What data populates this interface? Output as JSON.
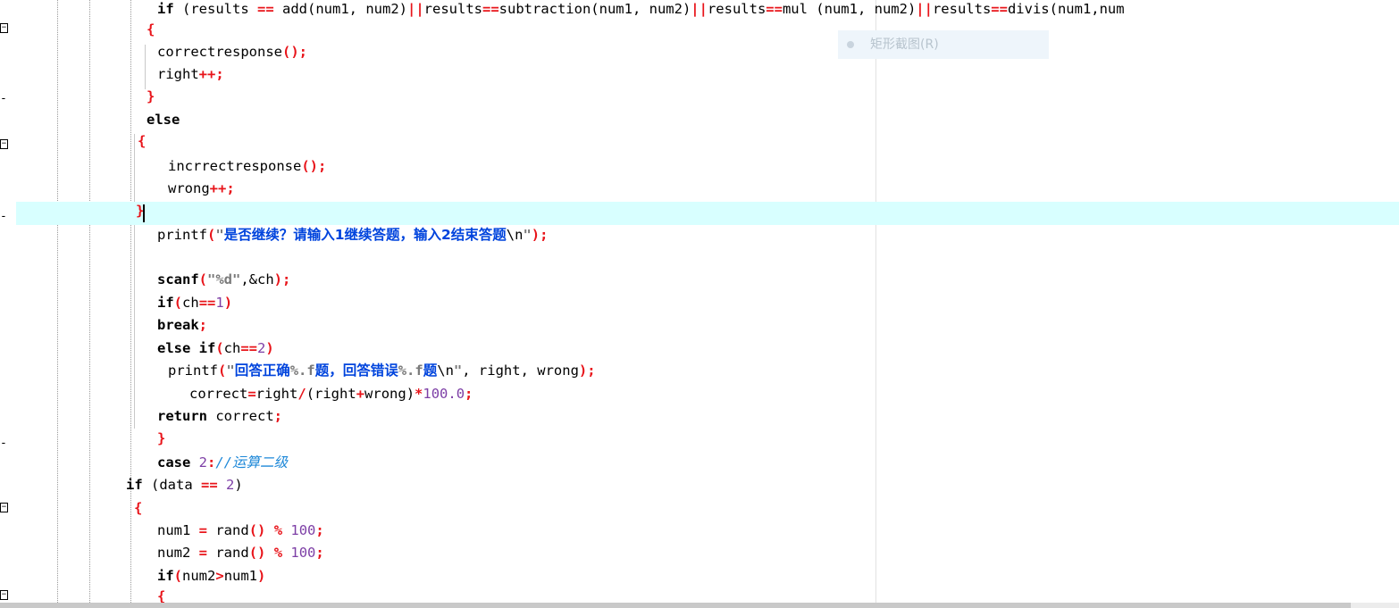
{
  "editor": {
    "lines": [
      [
        [
          "kw",
          "if"
        ],
        [
          "plain",
          " (results "
        ],
        [
          "op",
          "=="
        ],
        [
          "plain",
          " add(num1, num2)"
        ],
        [
          "op",
          "||"
        ],
        [
          "plain",
          "results"
        ],
        [
          "op",
          "=="
        ],
        [
          "plain",
          "subtraction(num1, num2)"
        ],
        [
          "op",
          "||"
        ],
        [
          "plain",
          "results"
        ],
        [
          "op",
          "=="
        ],
        [
          "plain",
          "mul (num1, num2)"
        ],
        [
          "op",
          "||"
        ],
        [
          "plain",
          "results"
        ],
        [
          "op",
          "=="
        ],
        [
          "plain",
          "divis(num1,num"
        ]
      ],
      [
        [
          "op",
          "{"
        ]
      ],
      [
        [
          "plain",
          "correctresponse"
        ],
        [
          "op",
          "();"
        ]
      ],
      [
        [
          "plain",
          "right"
        ],
        [
          "op",
          "++;"
        ]
      ],
      [
        [
          "op",
          "}"
        ]
      ],
      [
        [
          "kw",
          "else"
        ]
      ],
      [
        [
          "op",
          "{"
        ]
      ],
      [
        [
          "plain",
          "incrrectresponse"
        ],
        [
          "op",
          "();"
        ]
      ],
      [
        [
          "plain",
          "wrong"
        ],
        [
          "op",
          "++;"
        ]
      ],
      [
        [
          "op",
          "}"
        ]
      ],
      [
        [
          "plain",
          "printf"
        ],
        [
          "op",
          "("
        ],
        [
          "str",
          "\""
        ],
        [
          "cjk",
          "是否继续？请输入1继续答题，输入2结束答题"
        ],
        [
          "esc",
          "\\n"
        ],
        [
          "str",
          "\""
        ],
        [
          "op",
          ");"
        ]
      ],
      [
        [
          "kw",
          "scanf"
        ],
        [
          "op",
          "("
        ],
        [
          "str",
          "\"%d\""
        ],
        [
          "plain",
          ",&ch"
        ],
        [
          "op",
          ");"
        ]
      ],
      [
        [
          "kw",
          "if"
        ],
        [
          "op",
          "("
        ],
        [
          "plain",
          "ch"
        ],
        [
          "op",
          "=="
        ],
        [
          "num",
          "1"
        ],
        [
          "op",
          ")"
        ]
      ],
      [
        [
          "kw",
          "break"
        ],
        [
          "op",
          ";"
        ]
      ],
      [
        [
          "kw",
          "else if"
        ],
        [
          "op",
          "("
        ],
        [
          "plain",
          "ch"
        ],
        [
          "op",
          "=="
        ],
        [
          "num",
          "2"
        ],
        [
          "op",
          ")"
        ]
      ],
      [
        [
          "plain",
          "printf"
        ],
        [
          "op",
          "("
        ],
        [
          "str",
          "\""
        ],
        [
          "cjk",
          "回答正确"
        ],
        [
          "str",
          "%.f"
        ],
        [
          "cjk",
          "题，回答错误"
        ],
        [
          "str",
          "%.f"
        ],
        [
          "cjk",
          "题"
        ],
        [
          "esc",
          "\\n"
        ],
        [
          "str",
          "\""
        ],
        [
          "plain",
          ", right, wrong"
        ],
        [
          "op",
          ");"
        ]
      ],
      [
        [
          "plain",
          "correct"
        ],
        [
          "op",
          "="
        ],
        [
          "plain",
          "right"
        ],
        [
          "op",
          "/"
        ],
        [
          "plain",
          "(right"
        ],
        [
          "op",
          "+"
        ],
        [
          "plain",
          "wrong)"
        ],
        [
          "op",
          "*"
        ],
        [
          "num",
          "100.0"
        ],
        [
          "op",
          ";"
        ]
      ],
      [
        [
          "kw",
          "return"
        ],
        [
          "plain",
          " correct"
        ],
        [
          "op",
          ";"
        ]
      ],
      [
        [
          "op",
          "}"
        ]
      ],
      [
        [
          "kw",
          "case"
        ],
        [
          "num",
          " 2"
        ],
        [
          "op",
          ":"
        ],
        [
          "comment",
          "//运算二级"
        ]
      ],
      [
        [
          "kw",
          "if"
        ],
        [
          "plain",
          " (data "
        ],
        [
          "op",
          "=="
        ],
        [
          "num",
          " 2"
        ],
        [
          "plain",
          ")"
        ]
      ],
      [
        [
          "op",
          "{"
        ]
      ],
      [
        [
          "plain",
          "num1 "
        ],
        [
          "op",
          "="
        ],
        [
          "plain",
          " rand"
        ],
        [
          "op",
          "()"
        ],
        [
          "plain",
          " "
        ],
        [
          "op",
          "%"
        ],
        [
          "num",
          " 100"
        ],
        [
          "op",
          ";"
        ]
      ],
      [
        [
          "plain",
          "num2 "
        ],
        [
          "op",
          "="
        ],
        [
          "plain",
          " rand"
        ],
        [
          "op",
          "()"
        ],
        [
          "plain",
          " "
        ],
        [
          "op",
          "%"
        ],
        [
          "num",
          " 100"
        ],
        [
          "op",
          ";"
        ]
      ],
      [
        [
          "kw",
          "if"
        ],
        [
          "op",
          "("
        ],
        [
          "plain",
          "num2"
        ],
        [
          "op",
          ">"
        ],
        [
          "plain",
          "num1"
        ],
        [
          "op",
          ")"
        ]
      ],
      [
        [
          "op",
          "{"
        ]
      ]
    ],
    "fold_markers": [
      "⊟",
      "-",
      "⊟",
      "-",
      "-",
      "⊟",
      "⊟"
    ],
    "current_line_index": 9
  },
  "tooltip": {
    "label": "矩形截图(R)"
  }
}
